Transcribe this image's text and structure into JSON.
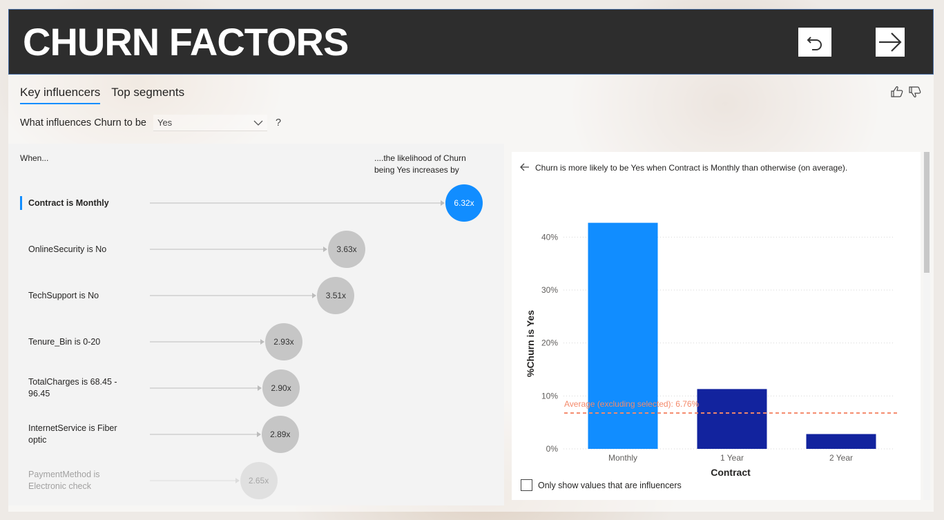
{
  "header": {
    "title": "CHURN FACTORS"
  },
  "tabs": [
    {
      "label": "Key influencers"
    },
    {
      "label": "Top segments"
    }
  ],
  "question": {
    "prefix": "What influences Churn to be",
    "value": "Yes",
    "suffix": "?"
  },
  "columns": {
    "when": "When...",
    "likely_line1": "....the likelihood of Churn",
    "likely_line2": "being Yes increases by"
  },
  "influencers": [
    {
      "label": "Contract is Monthly",
      "value": "6.32x",
      "selected": true
    },
    {
      "label": "OnlineSecurity is No",
      "value": "3.63x"
    },
    {
      "label": "TechSupport is No",
      "value": "3.51x"
    },
    {
      "label": "Tenure_Bin is 0-20",
      "value": "2.93x"
    },
    {
      "label": "TotalCharges is 68.45 - 96.45",
      "value": "2.90x"
    },
    {
      "label": "InternetService is Fiber optic",
      "value": "2.89x"
    },
    {
      "label": "PaymentMethod is Electronic check",
      "value": "2.65x"
    }
  ],
  "detail": {
    "explanation": "Churn is more likely to be Yes when Contract is Monthly than otherwise (on average).",
    "checkbox_label": "Only show values that are influencers"
  },
  "colors": {
    "accent": "#118dff",
    "dark_bar": "#12239e",
    "average_line": "#f4896a",
    "header_bg": "#2d2d2d"
  },
  "chart_data": {
    "type": "bar",
    "categories": [
      "Monthly",
      "1 Year",
      "2 Year"
    ],
    "values": [
      42.7,
      11.3,
      2.8
    ],
    "colors": [
      "#118dff",
      "#12239e",
      "#12239e"
    ],
    "xlabel": "Contract",
    "ylabel": "%Churn is Yes",
    "ylim": [
      0,
      45
    ],
    "yticks": [
      0,
      10,
      20,
      30,
      40
    ],
    "ytick_labels": [
      "0%",
      "10%",
      "20%",
      "30%",
      "40%"
    ],
    "reference_line": {
      "value": 6.76,
      "label": "Average (excluding selected): 6.76%"
    },
    "grid": true
  }
}
